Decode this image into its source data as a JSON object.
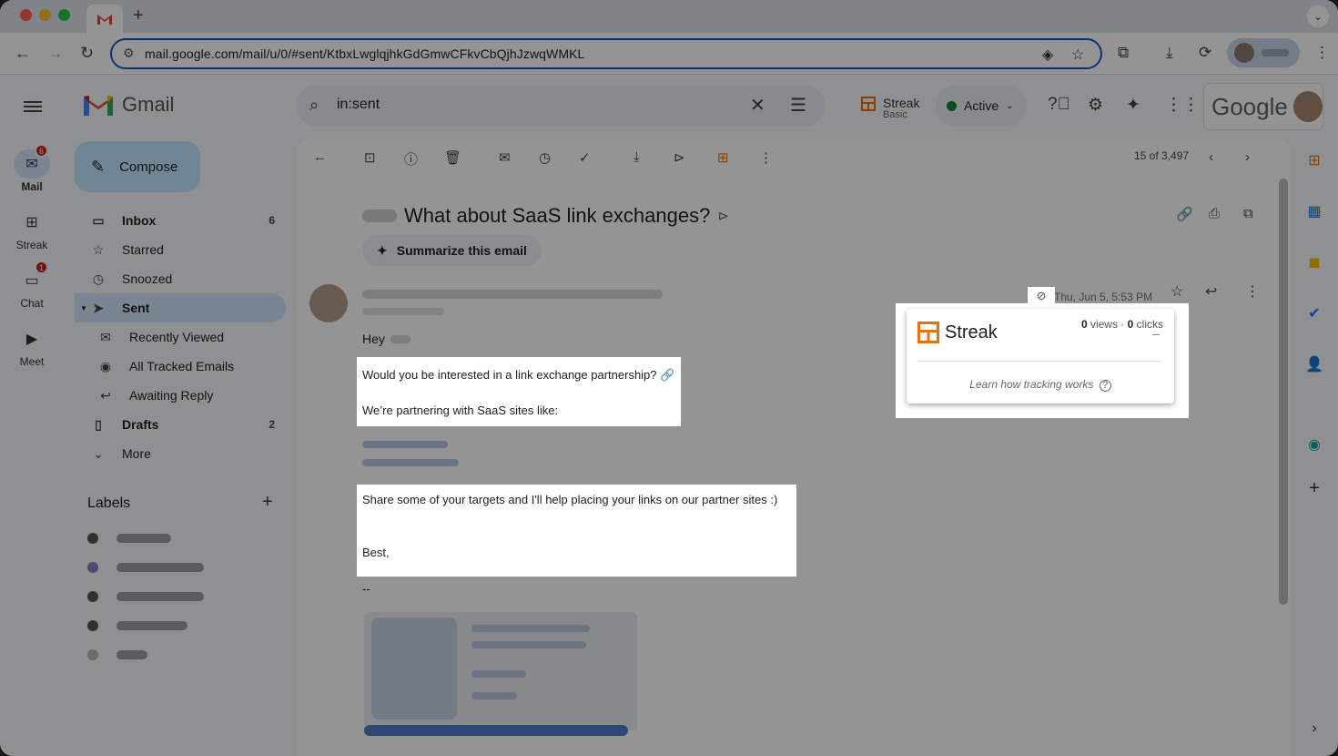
{
  "browser": {
    "url": "mail.google.com/mail/u/0/#sent/KtbxLwglqjhkGdGmwCFkvCbQjhJzwqWMKL",
    "new_tab": "+",
    "tab_menu": "⌄"
  },
  "app": {
    "name": "Gmail"
  },
  "rail": {
    "items": [
      {
        "label": "Mail",
        "badge": "6"
      },
      {
        "label": "Streak",
        "badge": ""
      },
      {
        "label": "Chat",
        "badge": "1"
      },
      {
        "label": "Meet",
        "badge": ""
      }
    ]
  },
  "compose": {
    "label": "Compose"
  },
  "nav": {
    "items": [
      {
        "label": "Inbox",
        "count": "6"
      },
      {
        "label": "Starred",
        "count": ""
      },
      {
        "label": "Snoozed",
        "count": ""
      },
      {
        "label": "Sent",
        "count": ""
      },
      {
        "label": "Recently Viewed",
        "count": ""
      },
      {
        "label": "All Tracked Emails",
        "count": ""
      },
      {
        "label": "Awaiting Reply",
        "count": ""
      },
      {
        "label": "Drafts",
        "count": "2"
      },
      {
        "label": "More",
        "count": ""
      }
    ]
  },
  "labels": {
    "title": "Labels",
    "add": "+"
  },
  "search": {
    "query": "in:sent"
  },
  "streak_badge": {
    "name": "Streak",
    "plan": "Basic"
  },
  "status": {
    "label": "Active"
  },
  "google": {
    "logo": "Google"
  },
  "pager": {
    "text": "15 of 3,497"
  },
  "email": {
    "subject": "What about SaaS link exchanges?",
    "summarize": "Summarize this email",
    "greeting": "Hey",
    "p1": "Would you be interested in a link exchange partnership? 🔗",
    "p2": "We’re partnering with SaaS sites like:",
    "p3": "Share some of your targets and I'll help placing your links on our partner sites  :)",
    "signoff": "Best,",
    "dash": "--",
    "date": "Thu, Jun 5, 5:53 PM"
  },
  "tracker": {
    "brand": "Streak",
    "views": "0",
    "views_label": " views · ",
    "clicks": "0",
    "clicks_label": " clicks",
    "learn": "Learn how tracking works"
  }
}
